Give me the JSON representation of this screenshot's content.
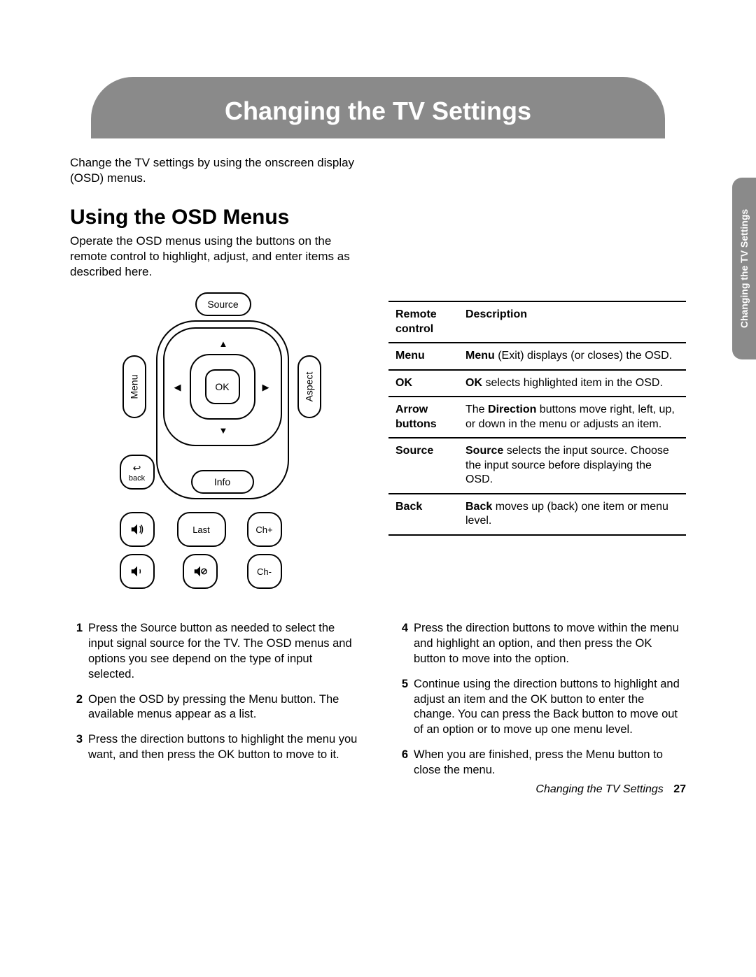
{
  "banner_title": "Changing the TV Settings",
  "side_tab": "Changing the TV Settings",
  "intro": "Change the TV settings by using the onscreen display (OSD) menus.",
  "section_title": "Using the OSD Menus",
  "section_desc": "Operate the OSD menus using the buttons on the remote control to highlight, adjust, and enter items as described here.",
  "remote": {
    "source": "Source",
    "menu": "Menu",
    "aspect": "Aspect",
    "ok": "OK",
    "back": "back",
    "info": "Info",
    "last": "Last",
    "ch_plus": "Ch+",
    "ch_minus": "Ch-"
  },
  "table": {
    "header_left": "Remote control",
    "header_right": "Description",
    "rows": [
      {
        "k": "Menu",
        "b": "Menu",
        "rest": " (Exit) displays (or closes) the OSD."
      },
      {
        "k": "OK",
        "b": "OK",
        "rest": " selects highlighted item in the OSD."
      },
      {
        "k": "Arrow buttons",
        "b": "Direction",
        "pre": "The ",
        "rest": " buttons move right, left, up, or down in the menu or adjusts an item."
      },
      {
        "k": "Source",
        "b": "Source",
        "rest": " selects the input source. Choose the input source before displaying the OSD."
      },
      {
        "k": "Back",
        "b": "Back",
        "rest": " moves up (back) one item or menu level."
      }
    ]
  },
  "steps_left": [
    {
      "n": "1",
      "t": "Press the Source button as needed to select the input signal source for the TV. The OSD menus and options you see depend on the type of input selected."
    },
    {
      "n": "2",
      "t": "Open the OSD by pressing the Menu button. The available menus appear as a list."
    },
    {
      "n": "3",
      "t": "Press the direction buttons to highlight the menu you want, and then press the OK button to move to it."
    }
  ],
  "steps_right": [
    {
      "n": "4",
      "t": "Press the direction buttons to move within the menu and highlight an option, and then press the OK button to move into the option."
    },
    {
      "n": "5",
      "t": "Continue using the direction buttons to highlight and adjust an item and the OK button to enter the change. You can press the Back button to move out of an option or to move up one menu level."
    },
    {
      "n": "6",
      "t": "When you are finished, press the Menu button to close the menu."
    }
  ],
  "footer_title": "Changing the TV Settings",
  "footer_page": "27"
}
